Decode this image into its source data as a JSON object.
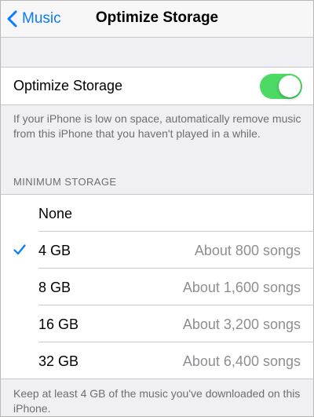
{
  "navbar": {
    "back_label": "Music",
    "title": "Optimize Storage"
  },
  "optimize": {
    "label": "Optimize Storage",
    "enabled": true,
    "footer": "If your iPhone is low on space, automatically remove music from this iPhone that you haven't played in a while."
  },
  "minimum_storage": {
    "header": "MINIMUM STORAGE",
    "options": [
      {
        "label": "None",
        "detail": "",
        "selected": false
      },
      {
        "label": "4 GB",
        "detail": "About 800 songs",
        "selected": true
      },
      {
        "label": "8 GB",
        "detail": "About 1,600 songs",
        "selected": false
      },
      {
        "label": "16 GB",
        "detail": "About 3,200 songs",
        "selected": false
      },
      {
        "label": "32 GB",
        "detail": "About 6,400 songs",
        "selected": false
      }
    ],
    "footer": "Keep at least 4 GB of the music you've downloaded on this iPhone."
  },
  "colors": {
    "accent": "#0a7aff",
    "switch_on": "#4cd964",
    "secondary_text": "#6d6d72",
    "detail_text": "#8e8e93"
  },
  "icons": {
    "back": "chevron-left-icon",
    "selected": "checkmark-icon"
  }
}
